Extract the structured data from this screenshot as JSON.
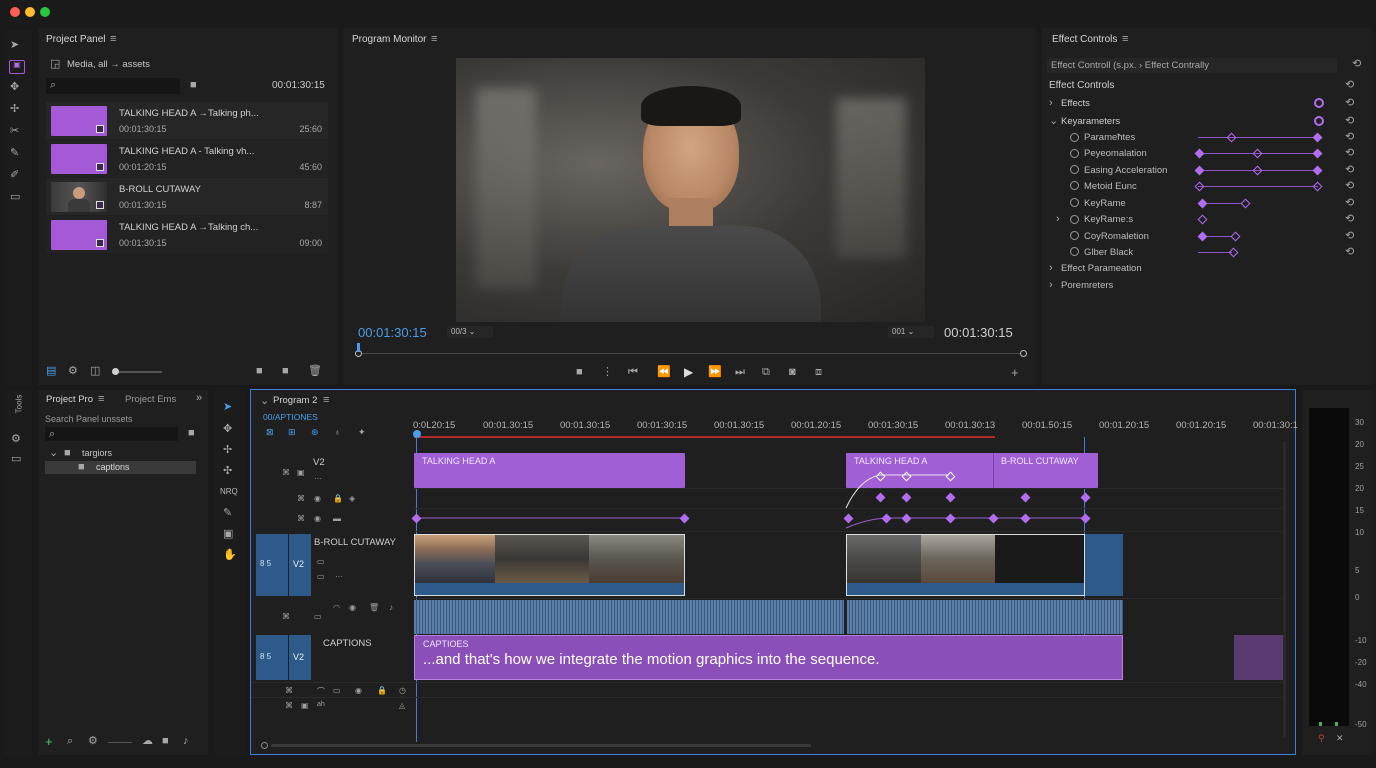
{
  "app": {
    "colors": {
      "accent": "#a45ad6",
      "timecode": "#4a9de8",
      "playhead": "#3f7fe0"
    }
  },
  "project_panel": {
    "title": "Project Panel",
    "breadcrumb": "Media, all → assets",
    "search_placeholder": "",
    "timecode": "00:01:30:15",
    "items": [
      {
        "name": "TALKING HEAD A →Talking ph...",
        "time": "00:01:30:15",
        "duration": "25:60",
        "thumb": "purple"
      },
      {
        "name": "TALKING HEAD A - Talking vh...",
        "time": "00:01:20:15",
        "duration": "45:60",
        "thumb": "purple"
      },
      {
        "name": "B-ROLL CUTAWAY",
        "time": "00:01:30:15",
        "duration": "8:87",
        "thumb": "person"
      },
      {
        "name": "TALKING HEAD A →Talking ch...",
        "time": "00:01:30:15",
        "duration": "09:00",
        "thumb": "purple"
      }
    ]
  },
  "program_monitor": {
    "title": "Program Monitor",
    "timecode_left": "00:01:30:15",
    "timecode_right": "00:01:30:15",
    "zoom_select": "00/3",
    "quality_select": "001"
  },
  "effect_controls": {
    "title": "Effect Controls",
    "breadcrumb": "Effect Controll (s.px. › Effect Contrally",
    "section": "Effect Controls",
    "rows": [
      {
        "label": "Effects",
        "type": "group",
        "expanded": false
      },
      {
        "label": "Keyarameters",
        "type": "group",
        "expanded": true
      },
      {
        "label": "Parameħtes",
        "type": "param"
      },
      {
        "label": "Peyeomalation",
        "type": "param"
      },
      {
        "label": "Easing Acceleration",
        "type": "param"
      },
      {
        "label": "Metoid Eunc",
        "type": "param"
      },
      {
        "label": "KeyRame",
        "type": "param"
      },
      {
        "label": "KeyRame:s",
        "type": "param"
      },
      {
        "label": "CoyRomaletion",
        "type": "param"
      },
      {
        "label": "Glber Black",
        "type": "param"
      },
      {
        "label": "Effect Parameation",
        "type": "group",
        "expanded": false
      },
      {
        "label": "Poremreters",
        "type": "group",
        "expanded": false
      }
    ]
  },
  "bin_panel": {
    "tab1": "Project Pro",
    "tab2": "Project Ems",
    "search_label": "Search Panel unssets",
    "folder1": "targiors",
    "folder2": "captlons"
  },
  "timeline": {
    "tab": "Program 2",
    "sub": "00/APTIONES",
    "nrq_label": "NRQ",
    "ruler": [
      "0:0L20:15",
      "00:01.30:15",
      "00:01.30:15",
      "00:01:30:15",
      "00:01.30:15",
      "00:01.20:15",
      "00:01:30:15",
      "00:01.30:13",
      "00:01.50:15",
      "00:01.20:15",
      "00:01.20:15",
      "00:01:30:1"
    ],
    "tracks": {
      "v2_label": "V2",
      "broll_label": "B-ROLL CUTAWAY",
      "captions_label": "CAPTIONS",
      "v2a": "V2",
      "v2b": "V2"
    },
    "clips": {
      "talking_head_1": "TALKING HEAD A",
      "talking_head_2": "TALKING HEAD A",
      "broll_top": "B-ROLL CUTAWAY",
      "captions_title": "CAPTIOES",
      "captions_text": "...and that's how we integrate the motion graphics into the sequence."
    },
    "vu_labels": [
      "30",
      "20",
      "25",
      "20",
      "15",
      "10",
      "5",
      "0",
      "-10",
      "-20",
      "-40",
      "-50"
    ]
  }
}
